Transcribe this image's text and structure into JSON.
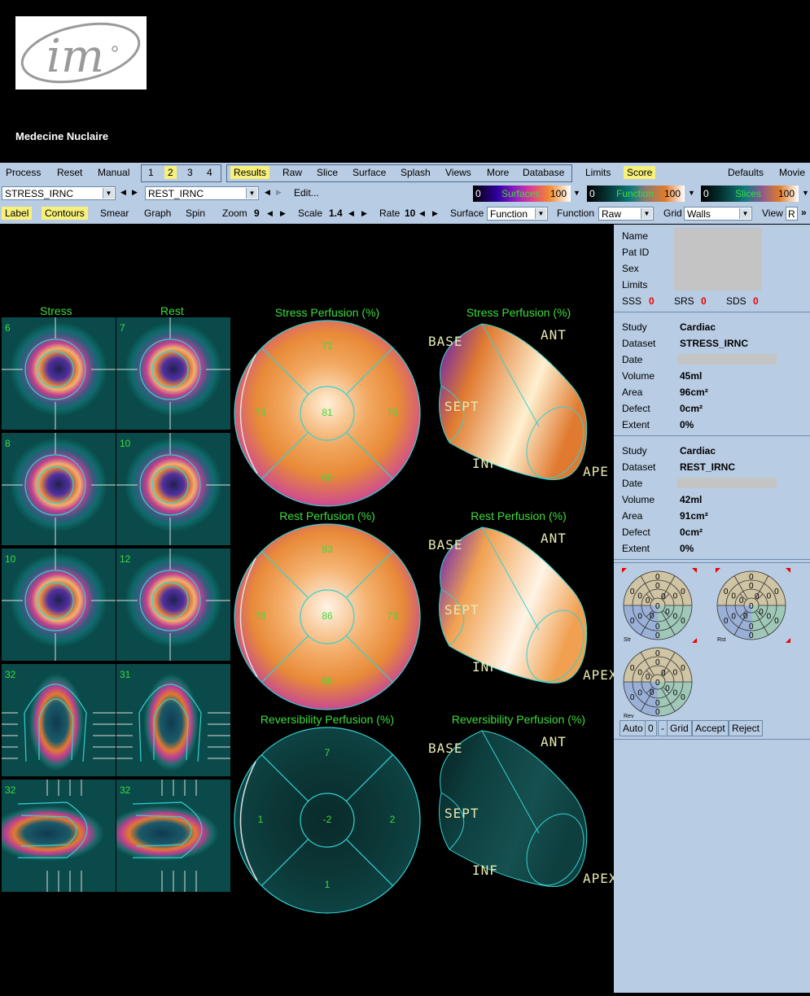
{
  "header": {
    "department": "Medecine Nuclaire"
  },
  "toolbar1": {
    "left": [
      "Process",
      "Reset",
      "Manual"
    ],
    "pages": [
      "1",
      "2",
      "3",
      "4"
    ],
    "active_page": "2",
    "views": [
      "Results",
      "Raw",
      "Slice",
      "Surface",
      "Splash",
      "Views",
      "More",
      "Database"
    ],
    "active_view": "Results",
    "limits": "Limits",
    "score": "Score",
    "defaults": "Defaults",
    "movie": "Movie"
  },
  "toolbar2": {
    "dataset1": "STRESS_IRNC",
    "dataset2": "REST_IRNC",
    "edit": "Edit...",
    "colorbars": [
      {
        "min": "0",
        "label": "Surfaces",
        "max": "100"
      },
      {
        "min": "0",
        "label": "Function",
        "max": "100"
      },
      {
        "min": "0",
        "label": "Slices",
        "max": "100"
      }
    ]
  },
  "toolbar3": {
    "label": "Label",
    "contours": "Contours",
    "smear": "Smear",
    "graph": "Graph",
    "spin": "Spin",
    "zoom_label": "Zoom",
    "zoom_value": "9",
    "scale_label": "Scale",
    "scale_value": "1.4",
    "rate_label": "Rate",
    "rate_value": "10",
    "surface_label": "Surface",
    "surface_value": "Function",
    "function_label": "Function",
    "function_value": "Raw",
    "grid_label": "Grid",
    "grid_value": "Walls",
    "view_label": "View",
    "view_value": "R"
  },
  "slices": {
    "stress_title": "Stress",
    "rest_title": "Rest",
    "stress_numbers": [
      "6",
      "8",
      "10",
      "32",
      "32"
    ],
    "rest_numbers": [
      "7",
      "10",
      "12",
      "31",
      "32"
    ]
  },
  "polar": [
    {
      "title": "Stress Perfusion (%)",
      "top": "71",
      "left": "73",
      "center": "81",
      "right": "70",
      "bottom": "60"
    },
    {
      "title": "Rest Perfusion (%)",
      "top": "83",
      "left": "78",
      "center": "86",
      "right": "73",
      "bottom": "65"
    },
    {
      "title": "Reversibility Perfusion (%)",
      "top": "7",
      "left": "1",
      "center": "-2",
      "right": "2",
      "bottom": "1"
    }
  ],
  "surfaces": [
    {
      "title": "Stress Perfusion (%)",
      "base": "BASE",
      "ant": "ANT",
      "sept": "SEPT",
      "inf": "INF",
      "apex": "APE"
    },
    {
      "title": "Rest Perfusion (%)",
      "base": "BASE",
      "ant": "ANT",
      "sept": "SEPT",
      "inf": "INF",
      "apex": "APEX"
    },
    {
      "title": "Reversibility Perfusion (%)",
      "base": "BASE",
      "ant": "ANT",
      "sept": "SEPT",
      "inf": "INF",
      "apex": "APEX"
    }
  ],
  "patient": {
    "name_label": "Name",
    "patid_label": "Pat ID",
    "sex_label": "Sex",
    "limits_label": "Limits",
    "sss_label": "SSS",
    "sss": "0",
    "srs_label": "SRS",
    "srs": "0",
    "sds_label": "SDS",
    "sds": "0"
  },
  "stress_info": {
    "study_label": "Study",
    "study": "Cardiac",
    "dataset_label": "Dataset",
    "dataset": "STRESS_IRNC",
    "date_label": "Date",
    "volume_label": "Volume",
    "volume": "45ml",
    "area_label": "Area",
    "area": "96cm²",
    "defect_label": "Defect",
    "defect": "0cm²",
    "extent_label": "Extent",
    "extent": "0%"
  },
  "rest_info": {
    "study_label": "Study",
    "study": "Cardiac",
    "dataset_label": "Dataset",
    "dataset": "REST_IRNC",
    "date_label": "Date",
    "volume_label": "Volume",
    "volume": "42ml",
    "area_label": "Area",
    "area": "91cm²",
    "defect_label": "Defect",
    "defect": "0cm²",
    "extent_label": "Extent",
    "extent": "0%"
  },
  "scores": {
    "labels": [
      "Str",
      "Rst",
      "Rev"
    ],
    "value": "0",
    "buttons": [
      "Auto",
      "0",
      "-",
      "Grid",
      "Accept",
      "Reject"
    ]
  },
  "colors": {
    "panel": "#b8cce4",
    "highlight": "#f7f07a",
    "green_text": "#3ddc3d",
    "contour": "#33d1d1"
  }
}
